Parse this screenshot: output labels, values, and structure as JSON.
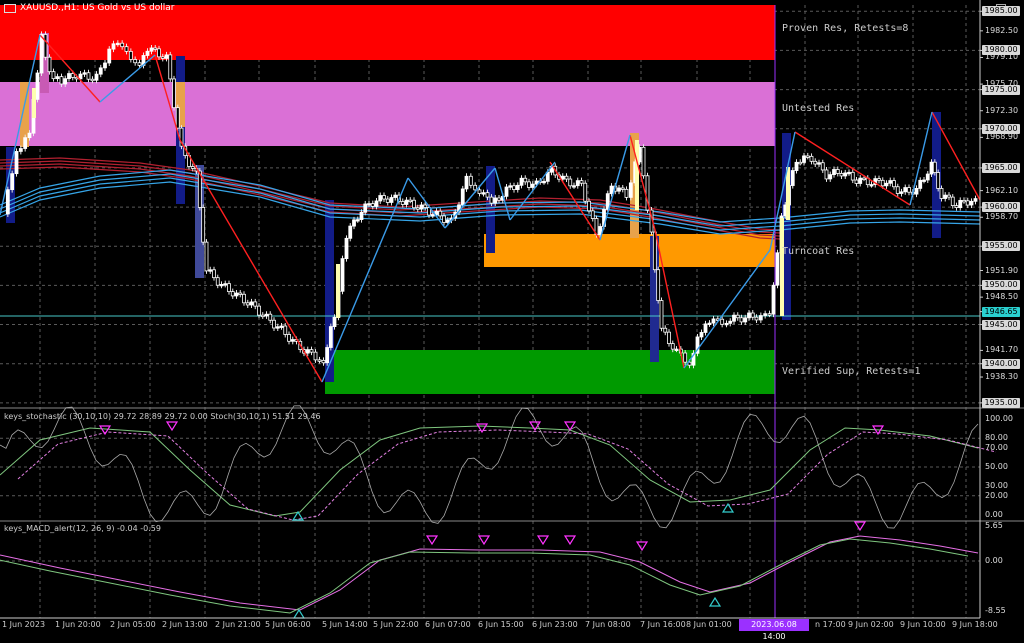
{
  "title": {
    "symbol": "XAUUSD.,H1: US Gold vs US dollar"
  },
  "indicators": {
    "stoch": "keys_stochastic (30,10,10) 29.72 28.89 29.72 0.00 Stoch(30,10,1) 51.51 29.46",
    "macd": "keys_MACD_alert(12, 26, 9) -0.04 -0.59"
  },
  "zones": {
    "proven_res": "Proven Res, Retests=8",
    "untested_res": "Untested Res",
    "turncoat_res": "Turncoat Res",
    "verified_sup": "Verified Sup, Retests=1"
  },
  "price_axis": [
    "1985.00",
    "1982.50",
    "1980.00",
    "1979.10",
    "1975.70",
    "1975.00",
    "1972.30",
    "1970.00",
    "1968.90",
    "1965.00",
    "1962.10",
    "1960.00",
    "1958.70",
    "1955.00",
    "1951.90",
    "1950.00",
    "1948.50",
    "1946.65",
    "1945.00",
    "1941.70",
    "1940.00",
    "1938.30",
    "1935.00"
  ],
  "stoch_axis": [
    "100.00",
    "80.00",
    "70.00",
    "50.00",
    "30.00",
    "20.00",
    "0.00"
  ],
  "macd_axis": [
    "5.65",
    "0.00",
    "-8.55"
  ],
  "time_axis": [
    "1 Jun 2023",
    "1 Jun 20:00",
    "2 Jun 05:00",
    "2 Jun 13:00",
    "2 Jun 21:00",
    "5 Jun 06:00",
    "5 Jun 14:00",
    "5 Jun 22:00",
    "6 Jun 07:00",
    "6 Jun 15:00",
    "6 Jun 23:00",
    "7 Jun 08:00",
    "7 Jun 16:00",
    "8 Jun 01:00",
    "2023.06.08 14:00",
    "n 17:00",
    "9 Jun 02:00",
    "9 Jun 10:00",
    "9 Jun 18:00"
  ],
  "current_price": "1946.65",
  "colors": {
    "bg": "#000000",
    "proven": "#ff0000",
    "untested": "#da70d6",
    "turncoat": "#ff9900",
    "verified": "#009a00",
    "ma_red": "#b22030",
    "ma_blue": "#36a5e8",
    "zigzag_red": "#ff2020",
    "zigzag_blue": "#3a9be8",
    "stoch_main": "#7fc67f",
    "stoch_signal": "#e07fe0",
    "stoch_raw": "#a9a9a9",
    "arrow_magenta": "#ff33ff",
    "arrow_cyan": "#33cccc",
    "cursor": "#9b30ff",
    "bar_navy": "#101a80",
    "bar_yellow": "#ffffb0"
  }
}
